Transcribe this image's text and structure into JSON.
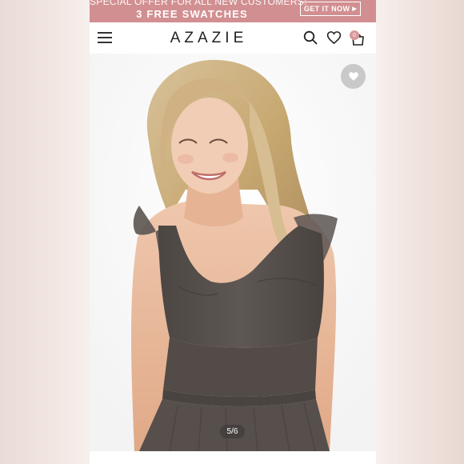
{
  "promo": {
    "line1": "SPECIAL OFFER FOR ALL NEW CUSTOMERS:",
    "line2": "3 FREE SWATCHES",
    "cta": "GET IT NOW",
    "color": "#d28f91"
  },
  "header": {
    "logo": "AZAZIE",
    "icons": [
      "menu-icon",
      "search-icon",
      "heart-icon",
      "cart-icon"
    ],
    "cart_count": "0"
  },
  "gallery": {
    "counter": "5/6",
    "dress_color": "#59524f",
    "favorite_icon": "heart-icon"
  }
}
